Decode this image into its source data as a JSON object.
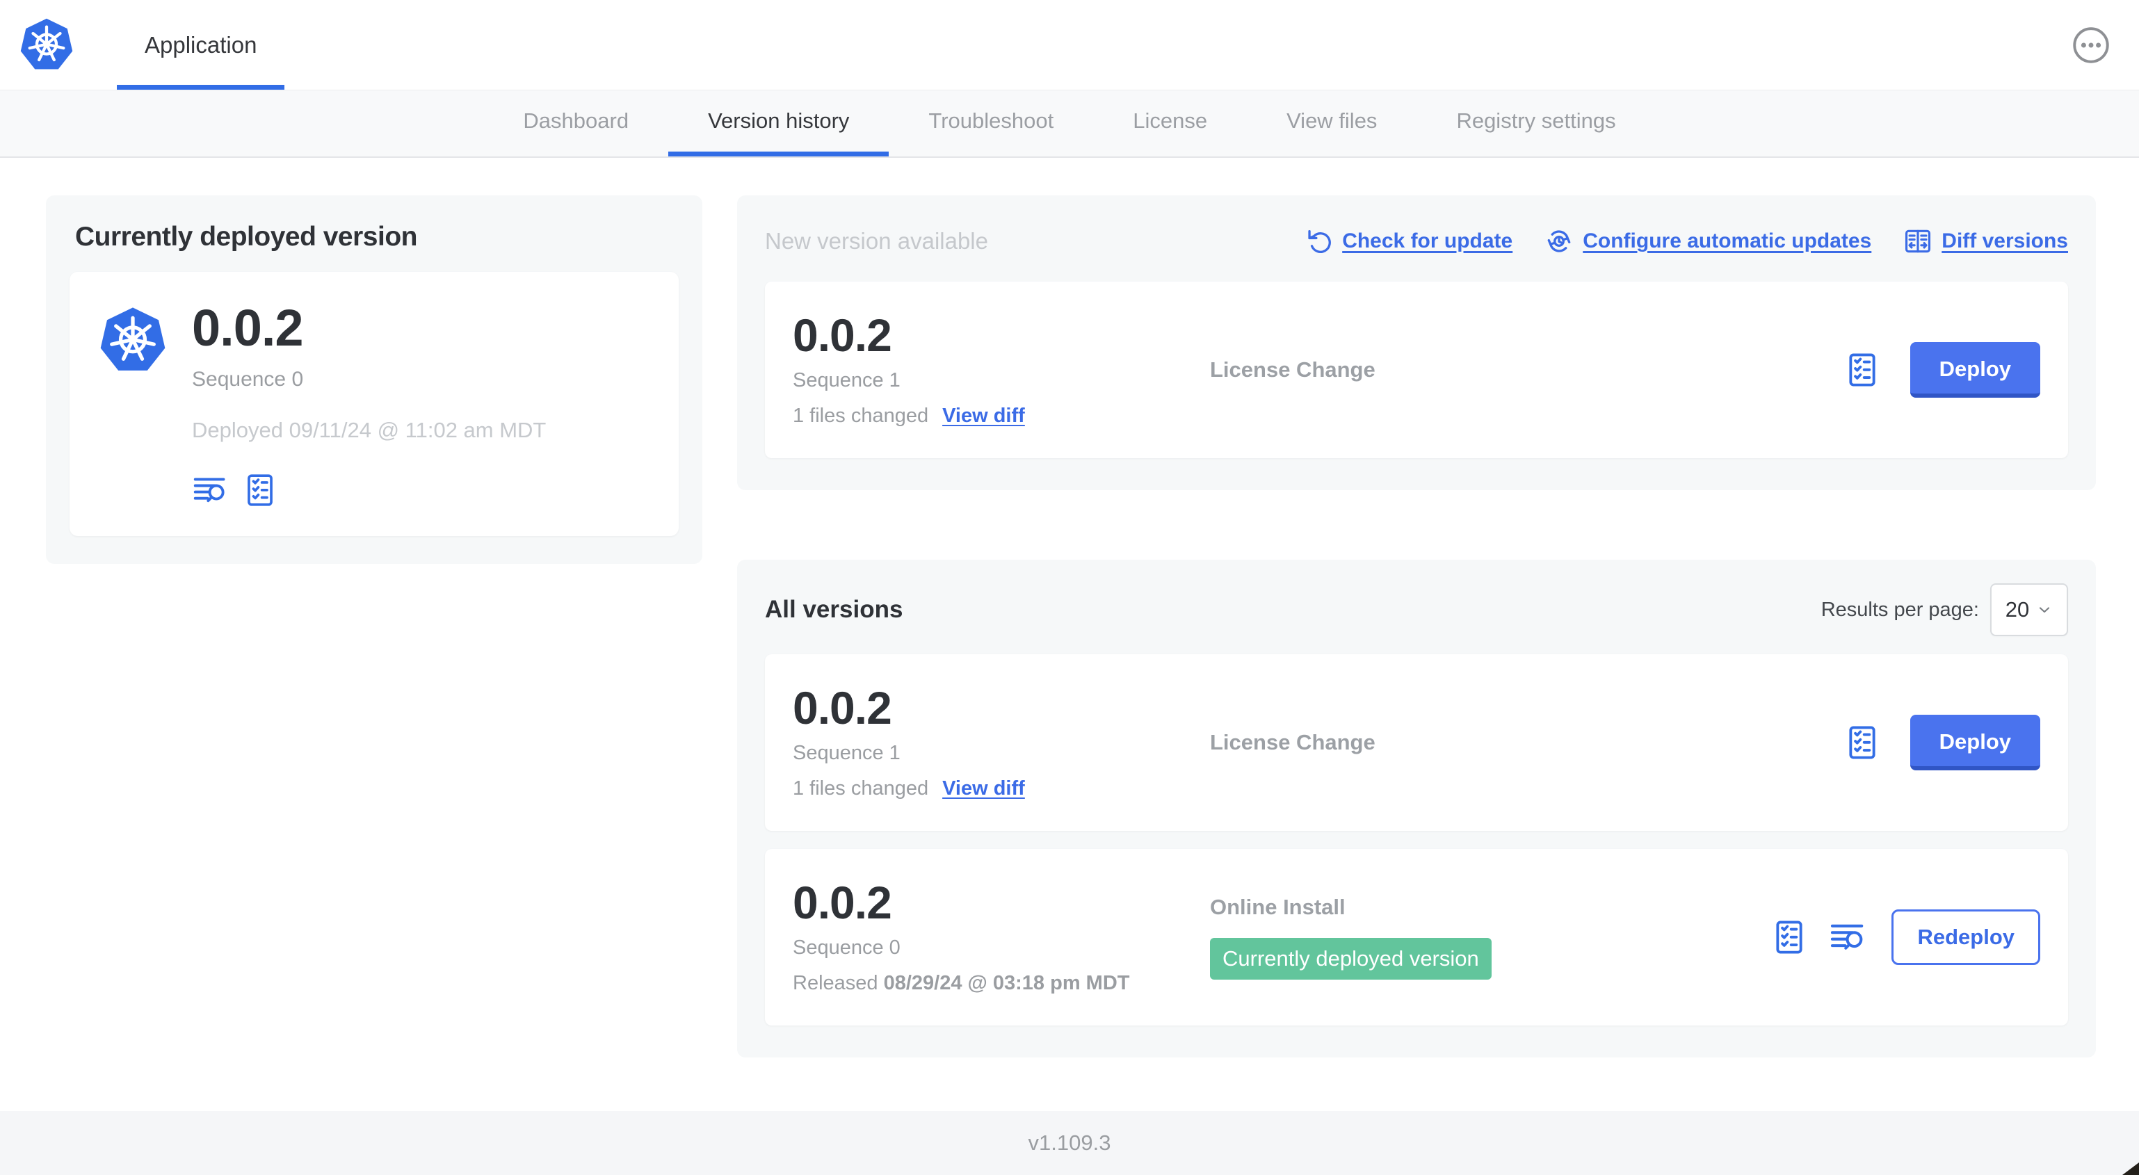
{
  "colors": {
    "accent_blue": "#326DE6",
    "button_blue": "#4A73EE",
    "button_blue_shade": "#3055C5",
    "badge_green": "#62C59C",
    "muted_gray": "#C5C8CC",
    "text_gray": "#9A9DA1",
    "text_dark": "#2F3237"
  },
  "header": {
    "logo_icon": "kubernetes-logo",
    "app_tab": "Application",
    "more_icon": "ellipsis-circle"
  },
  "nav": {
    "tabs": [
      {
        "label": "Dashboard",
        "active": false
      },
      {
        "label": "Version history",
        "active": true
      },
      {
        "label": "Troubleshoot",
        "active": false
      },
      {
        "label": "License",
        "active": false
      },
      {
        "label": "View files",
        "active": false
      },
      {
        "label": "Registry settings",
        "active": false
      }
    ]
  },
  "current_version_panel": {
    "title": "Currently deployed version",
    "version": "0.0.2",
    "sequence": "Sequence 0",
    "deployed": "Deployed 09/11/24 @ 11:02 am MDT",
    "icons": [
      "logs-icon",
      "config-checklist-icon"
    ]
  },
  "new_version_section": {
    "title": "New version available",
    "actions": [
      {
        "label": "Check for update",
        "icon": "refresh-icon"
      },
      {
        "label": "Configure automatic updates",
        "icon": "auto-update-clock-icon"
      },
      {
        "label": "Diff versions",
        "icon": "diff-icon"
      }
    ],
    "row": {
      "version": "0.0.2",
      "sequence": "Sequence 1",
      "files_changed": "1 files changed",
      "view_diff": "View diff",
      "source": "License Change",
      "action_label": "Deploy"
    }
  },
  "all_versions_section": {
    "title": "All versions",
    "results_per_page_label": "Results per page:",
    "results_per_page_value": "20",
    "rows": [
      {
        "version": "0.0.2",
        "sequence": "Sequence 1",
        "files_changed": "1 files changed",
        "view_diff": "View diff",
        "source": "License Change",
        "action_label": "Deploy"
      },
      {
        "version": "0.0.2",
        "sequence": "Sequence 0",
        "released_prefix": "Released",
        "released_date": "08/29/24 @ 03:18 pm MDT",
        "source": "Online Install",
        "badge": "Currently deployed version",
        "action_label": "Redeploy"
      }
    ]
  },
  "footer": {
    "version": "v1.109.3"
  }
}
